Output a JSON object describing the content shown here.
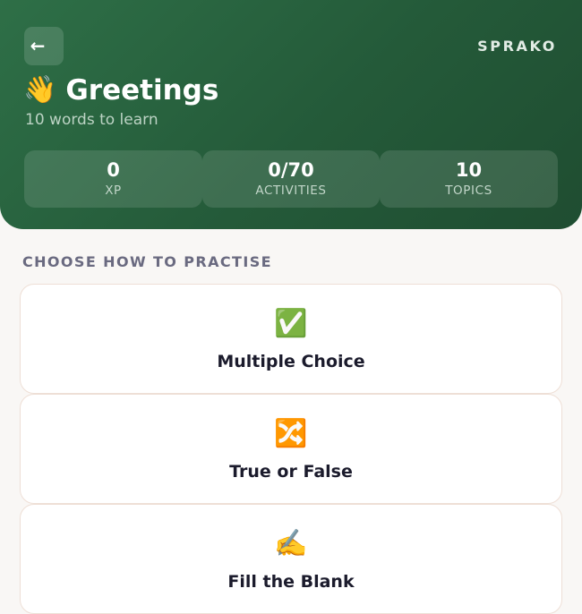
{
  "header": {
    "back_label": "←",
    "brand": "SPRAKO",
    "title_emoji": "👋",
    "title": "Greetings",
    "subtitle": "10 words to learn",
    "accent_color": "#2e6f47"
  },
  "stats": [
    {
      "value": "0",
      "label": "XP"
    },
    {
      "value": "0/70",
      "label": "ACTIVITIES"
    },
    {
      "value": "10",
      "label": "TOPICS"
    }
  ],
  "section_label": "CHOOSE HOW TO PRACTISE",
  "modes": [
    {
      "icon": "✅",
      "icon_name": "checkmark-icon",
      "label": "Multiple Choice"
    },
    {
      "icon": "🔀",
      "icon_name": "shuffle-icon",
      "label": "True or False"
    },
    {
      "icon": "✍️",
      "icon_name": "writing-hand-icon",
      "label": "Fill the Blank"
    }
  ]
}
